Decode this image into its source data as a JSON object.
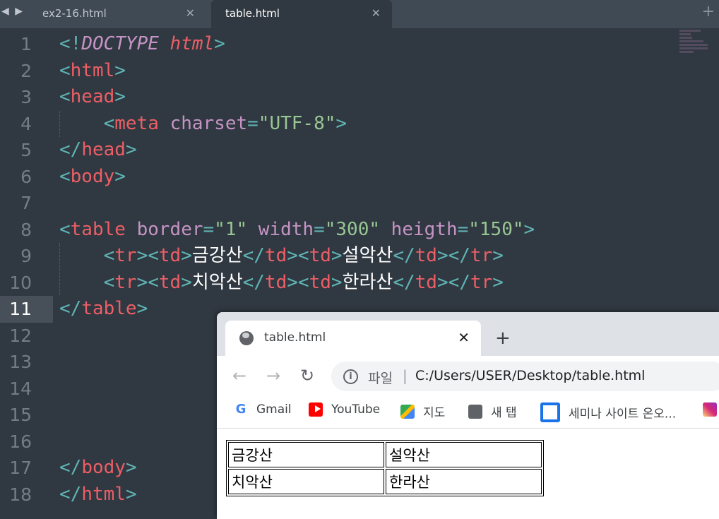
{
  "editor": {
    "tabs": [
      {
        "label": "ex2-16.html",
        "active": false
      },
      {
        "label": "table.html",
        "active": true
      }
    ],
    "line_numbers": [
      "1",
      "2",
      "3",
      "4",
      "5",
      "6",
      "7",
      "8",
      "9",
      "10",
      "11",
      "12",
      "13",
      "14",
      "15",
      "16",
      "17",
      "18"
    ],
    "current_line": "11",
    "code": {
      "l1_open": "<!",
      "l1_kw": "DOCTYPE",
      "l1_html": "html",
      "l1_close": ">",
      "html_tag": "html",
      "head_tag": "head",
      "meta_tag": "meta",
      "charset_attr": "charset",
      "charset_val": "\"UTF-8\"",
      "body_tag": "body",
      "table_tag": "table",
      "border_attr": "border",
      "border_val": "\"1\"",
      "width_attr": "width",
      "width_val": "\"300\"",
      "heigth_attr": "heigth",
      "heigth_val": "\"150\"",
      "tr_tag": "tr",
      "td_tag": "td",
      "cell_1": "금강산",
      "cell_2": "설악산",
      "cell_3": "치악산",
      "cell_4": "한라산"
    }
  },
  "browser": {
    "tab_title": "table.html",
    "address_scheme": "파일",
    "address_url": "C:/Users/USER/Desktop/table.html",
    "bookmarks": [
      {
        "label": "Gmail",
        "icon": "gmail-icon"
      },
      {
        "label": "YouTube",
        "icon": "youtube-icon"
      },
      {
        "label": "지도",
        "icon": "maps-icon"
      },
      {
        "label": "새 탭",
        "icon": "globe-icon"
      },
      {
        "label": "세미나 사이트 온오...",
        "icon": "seminar-icon"
      }
    ],
    "table": [
      [
        "금강산",
        "설악산"
      ],
      [
        "치악산",
        "한라산"
      ]
    ]
  }
}
